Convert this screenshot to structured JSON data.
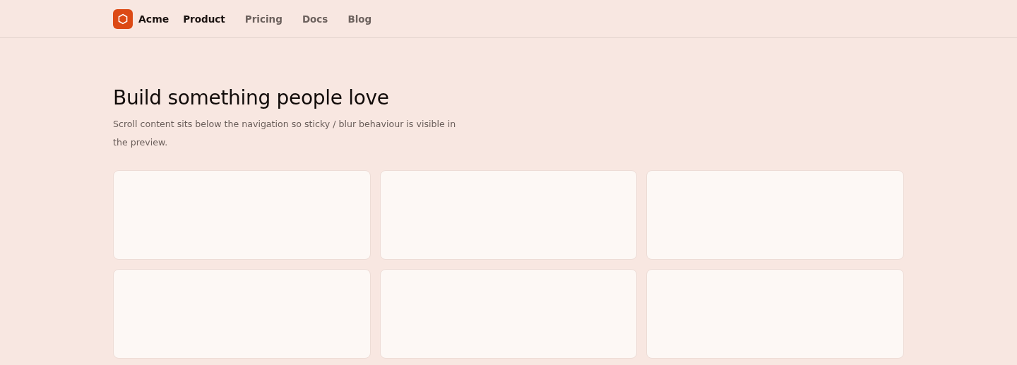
{
  "nav": {
    "brand": "Acme",
    "links": [
      {
        "label": "Product",
        "selected": true
      },
      {
        "label": "Pricing",
        "selected": false
      },
      {
        "label": "Docs",
        "selected": false
      },
      {
        "label": "Blog",
        "selected": false
      }
    ]
  },
  "hero": {
    "title": "Build something people love",
    "text": "Scroll content sits below the navigation so sticky / blur behaviour is visible in the preview."
  },
  "cards": [
    {
      "kind": "empty"
    },
    {
      "kind": "empty"
    },
    {
      "kind": "empty"
    },
    {
      "kind": "empty"
    },
    {
      "kind": "empty"
    },
    {
      "kind": "empty"
    }
  ]
}
